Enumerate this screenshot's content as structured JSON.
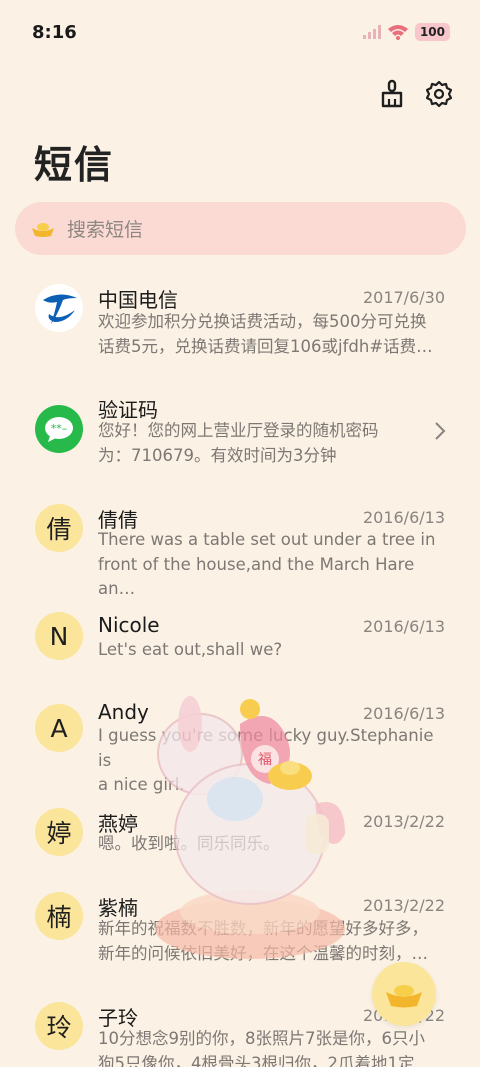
{
  "status": {
    "time": "8:16",
    "battery": "100"
  },
  "header": {
    "title": "短信"
  },
  "search": {
    "placeholder": "搜索短信"
  },
  "messages": [
    {
      "avatar": "",
      "name": "中国电信",
      "date": "2017/6/30",
      "line1": "欢迎参加积分兑换话费活动，每500分可兑换",
      "line2": "话费5元，兑换话费请回复106或jfdh#话费…"
    },
    {
      "avatar": "",
      "name": "验证码",
      "date": "",
      "line1": "您好！您的网上营业厅登录的随机密码",
      "line2": "为：710679。有效时间为3分钟"
    },
    {
      "avatar": "倩",
      "name": "倩倩",
      "date": "2016/6/13",
      "line1": "There was a table set out under a tree in",
      "line2": "front of the house,and the March Hare an…"
    },
    {
      "avatar": "N",
      "name": "Nicole",
      "date": "2016/6/13",
      "line1": "Let's eat out,shall we?",
      "line2": ""
    },
    {
      "avatar": "A",
      "name": "Andy",
      "date": "2016/6/13",
      "line1": "I guess you're some lucky guy.Stephanie is",
      "line2": "a nice girl."
    },
    {
      "avatar": "婷",
      "name": "燕婷",
      "date": "2013/2/22",
      "line1": "嗯。收到啦。同乐同乐。",
      "line2": ""
    },
    {
      "avatar": "楠",
      "name": "紫楠",
      "date": "2013/2/22",
      "line1": "新年的祝福数不胜数，新年的愿望好多好多，",
      "line2": "新年的问候依旧美好，在这个温馨的时刻，…"
    },
    {
      "avatar": "玲",
      "name": "子玲",
      "date": "2013/2/22",
      "line1": "10分想念9别的你，8张照片7张是你，6只小",
      "line2": "狗5只像你，4根骨头3根归你，2爪着地1定"
    }
  ],
  "colors": {
    "background": "#fbf2e5",
    "search": "#fadad3",
    "avatar": "#fbe59a",
    "telecom": "#0b5fb5",
    "green": "#27b94a"
  }
}
